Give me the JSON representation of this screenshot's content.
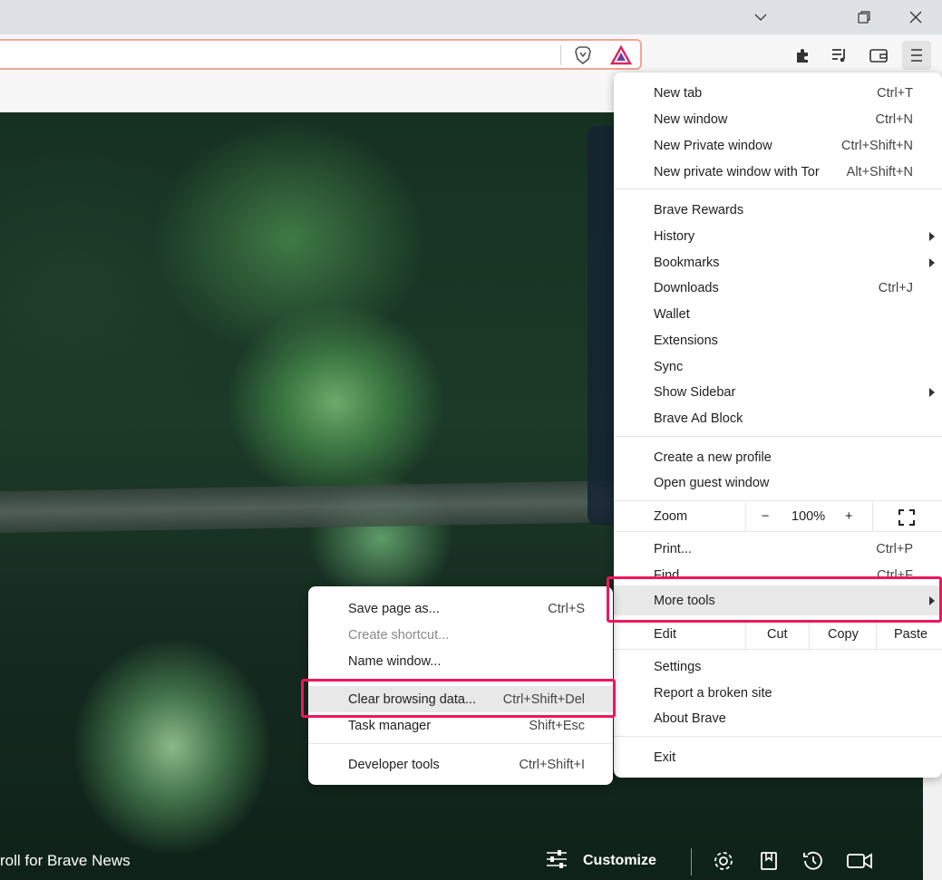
{
  "window": {
    "controls": [
      "chevron-down-icon",
      "restore-icon",
      "close-icon"
    ]
  },
  "toolbar": {
    "icons": [
      "brave-shields-icon",
      "brave-rewards-icon",
      "extensions-icon",
      "playlist-icon",
      "wallet-icon",
      "menu-icon"
    ]
  },
  "main_menu": {
    "items": [
      {
        "label": "New tab",
        "shortcut": "Ctrl+T"
      },
      {
        "label": "New window",
        "shortcut": "Ctrl+N"
      },
      {
        "label": "New Private window",
        "shortcut": "Ctrl+Shift+N"
      },
      {
        "label": "New private window with Tor",
        "shortcut": "Alt+Shift+N"
      },
      {
        "label": "Brave Rewards",
        "shortcut": ""
      },
      {
        "label": "History",
        "shortcut": ""
      },
      {
        "label": "Bookmarks",
        "shortcut": ""
      },
      {
        "label": "Downloads",
        "shortcut": "Ctrl+J"
      },
      {
        "label": "Wallet",
        "shortcut": ""
      },
      {
        "label": "Extensions",
        "shortcut": ""
      },
      {
        "label": "Sync",
        "shortcut": ""
      },
      {
        "label": "Show Sidebar",
        "shortcut": ""
      },
      {
        "label": "Brave Ad Block",
        "shortcut": ""
      },
      {
        "label": "Create a new profile",
        "shortcut": ""
      },
      {
        "label": "Open guest window",
        "shortcut": ""
      },
      {
        "label": "Print...",
        "shortcut": "Ctrl+P"
      },
      {
        "label": "Find...",
        "shortcut": "Ctrl+F"
      },
      {
        "label": "More tools",
        "shortcut": ""
      },
      {
        "label": "Settings",
        "shortcut": ""
      },
      {
        "label": "Report a broken site",
        "shortcut": ""
      },
      {
        "label": "About Brave",
        "shortcut": ""
      },
      {
        "label": "Exit",
        "shortcut": ""
      }
    ],
    "zoom": {
      "label": "Zoom",
      "minus": "−",
      "value": "100%",
      "plus": "+"
    },
    "edit": {
      "label": "Edit",
      "cut": "Cut",
      "copy": "Copy",
      "paste": "Paste"
    }
  },
  "sub_menu": {
    "items": [
      {
        "label": "Save page as...",
        "shortcut": "Ctrl+S"
      },
      {
        "label": "Create shortcut...",
        "shortcut": ""
      },
      {
        "label": "Name window...",
        "shortcut": ""
      },
      {
        "label": "Clear browsing data...",
        "shortcut": "Ctrl+Shift+Del"
      },
      {
        "label": "Task manager",
        "shortcut": "Shift+Esc"
      },
      {
        "label": "Developer tools",
        "shortcut": "Ctrl+Shift+I"
      }
    ]
  },
  "newtab": {
    "news_text": "roll for Brave News",
    "customize_label": "Customize"
  },
  "colors": {
    "highlight": "#f0165b"
  }
}
